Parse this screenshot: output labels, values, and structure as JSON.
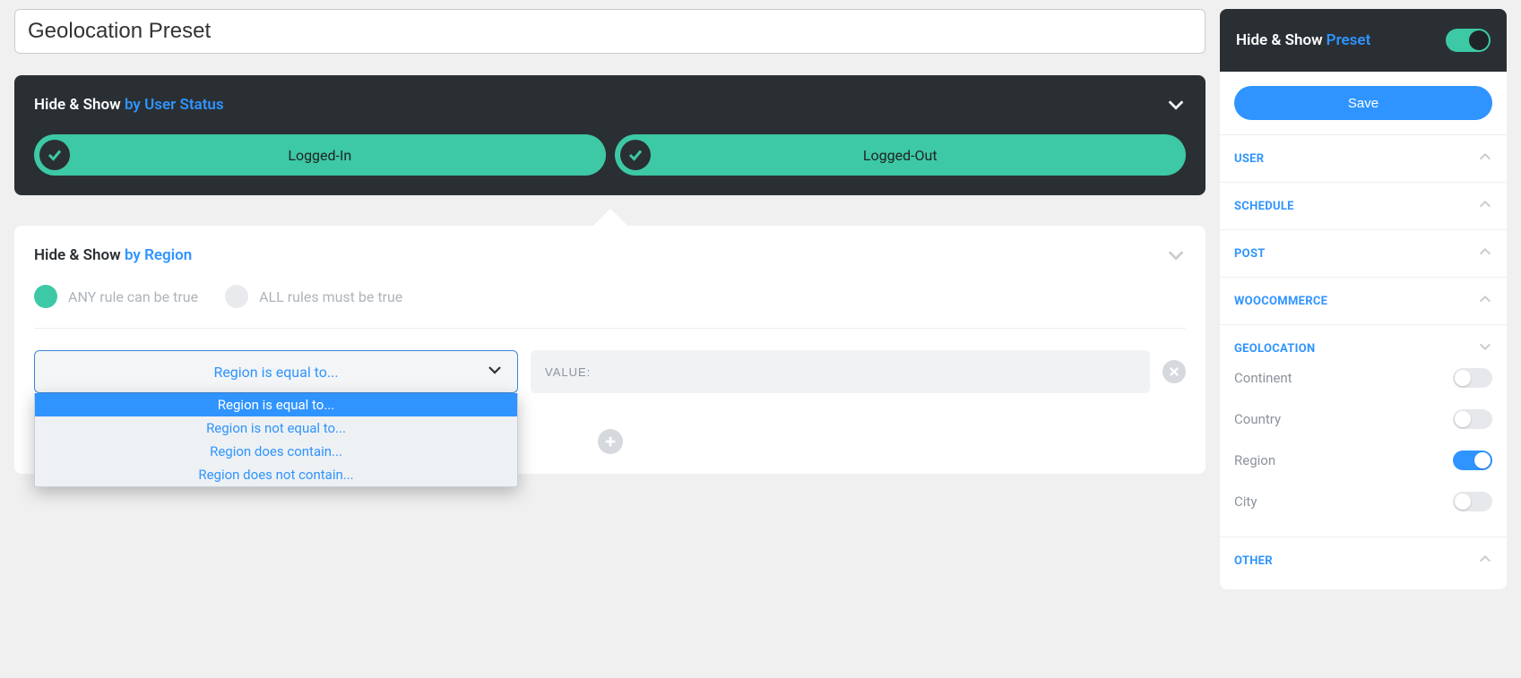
{
  "title_value": "Geolocation Preset",
  "panels": {
    "user_status": {
      "prefix": "Hide & Show",
      "sufx": "by User Status",
      "pills": {
        "0": "Logged-In",
        "1": "Logged-Out"
      }
    },
    "region": {
      "prefix": "Hide & Show",
      "sufx": "by Region",
      "modes": {
        "any": "ANY rule can be true",
        "all": "ALL rules must be true"
      },
      "select_value": "Region is equal to...",
      "options": {
        "0": "Region is equal to...",
        "1": "Region is not equal to...",
        "2": "Region does contain...",
        "3": "Region does not contain..."
      },
      "value_placeholder": "VALUE:"
    }
  },
  "sidebar": {
    "head_prefix": "Hide & Show",
    "head_sufx": "Preset",
    "save": "Save",
    "sections": {
      "user": "USER",
      "schedule": "SCHEDULE",
      "post": "POST",
      "woo": "WOOCOMMERCE",
      "geo": "GEOLOCATION",
      "other": "OTHER"
    },
    "geo_items": {
      "continent": "Continent",
      "country": "Country",
      "region": "Region",
      "city": "City"
    }
  }
}
